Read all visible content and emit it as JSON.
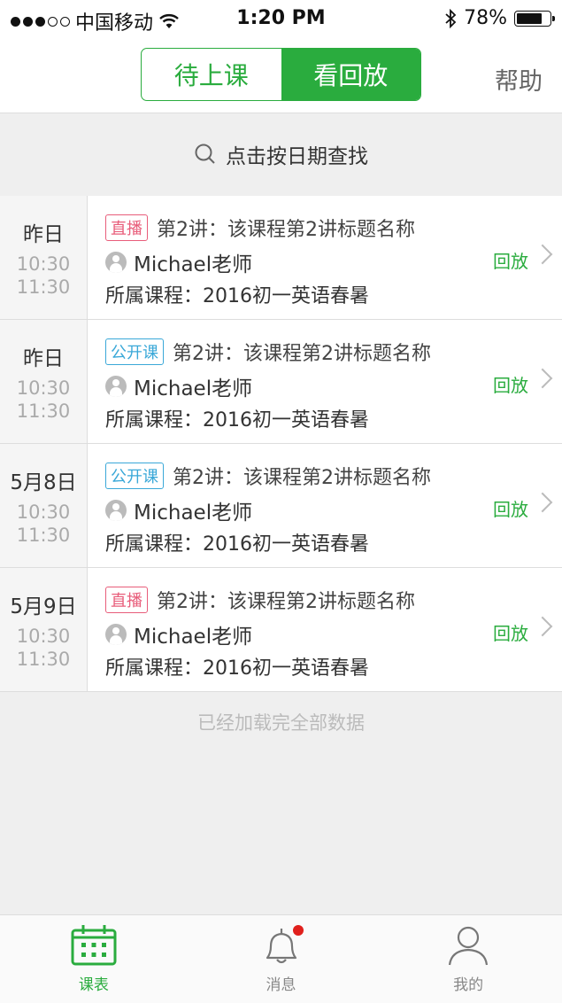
{
  "status_bar": {
    "carrier": "中国移动",
    "time": "1:20 PM",
    "battery_pct": "78%",
    "battery_level": 0.78
  },
  "nav": {
    "seg_upcoming": "待上课",
    "seg_replay": "看回放",
    "help": "帮助"
  },
  "search": {
    "label": "点击按日期查找"
  },
  "lessons": [
    {
      "date": "昨日",
      "start": "10:30",
      "end": "11:30",
      "tag": "直播",
      "tag_type": "live",
      "title": "第2讲：该课程第2讲标题名称",
      "teacher": "Michael老师",
      "course": "所属课程：2016初一英语春暑",
      "action": "回放"
    },
    {
      "date": "昨日",
      "start": "10:30",
      "end": "11:30",
      "tag": "公开课",
      "tag_type": "open",
      "title": "第2讲：该课程第2讲标题名称",
      "teacher": "Michael老师",
      "course": "所属课程：2016初一英语春暑",
      "action": "回放"
    },
    {
      "date": "5月8日",
      "start": "10:30",
      "end": "11:30",
      "tag": "公开课",
      "tag_type": "open",
      "title": "第2讲：该课程第2讲标题名称",
      "teacher": "Michael老师",
      "course": "所属课程：2016初一英语春暑",
      "action": "回放"
    },
    {
      "date": "5月9日",
      "start": "10:30",
      "end": "11:30",
      "tag": "直播",
      "tag_type": "live",
      "title": "第2讲：该课程第2讲标题名称",
      "teacher": "Michael老师",
      "course": "所属课程：2016初一英语春暑",
      "action": "回放"
    }
  ],
  "list_footer": "已经加载完全部数据",
  "tabbar": {
    "schedule": "课表",
    "messages": "消息",
    "me": "我的"
  },
  "colors": {
    "accent": "#2aac3e",
    "live_tag": "#e85d7a",
    "open_tag": "#3aa8d8",
    "badge": "#e0201c"
  }
}
